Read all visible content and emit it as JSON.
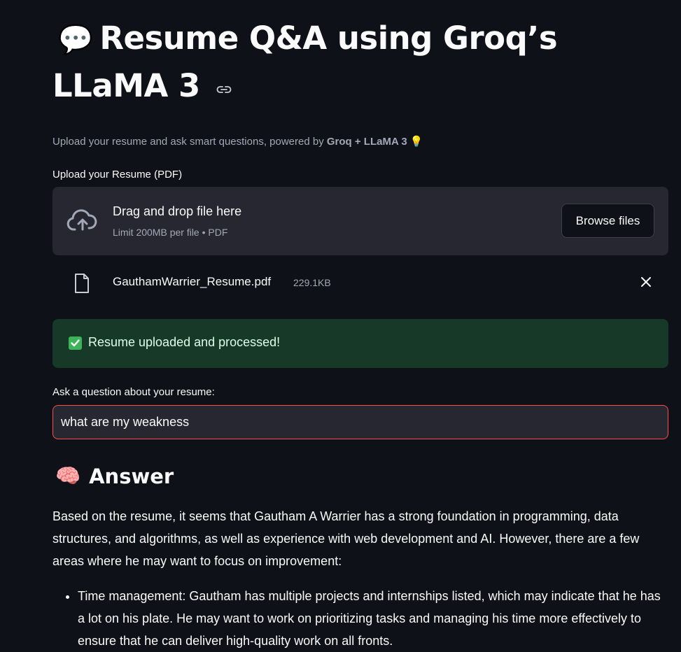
{
  "header": {
    "title_emoji": "💬",
    "title": "Resume Q&A using Groq’s LLaMA 3",
    "subtitle_prefix": "Upload your resume and ask smart questions, powered by",
    "subtitle_bold": "Groq + LLaMA 3",
    "subtitle_emoji": "💡"
  },
  "uploader": {
    "label": "Upload your Resume (PDF)",
    "dropzone_title": "Drag and drop file here",
    "dropzone_limit": "Limit 200MB per file • PDF",
    "browse_label": "Browse files",
    "file": {
      "name": "GauthamWarrier_Resume.pdf",
      "size": "229.1KB"
    }
  },
  "status": {
    "message": "Resume uploaded and processed!",
    "color": "#173928"
  },
  "question": {
    "label": "Ask a question about your resume:",
    "value": "what are my weakness"
  },
  "answer": {
    "heading_emoji": "🧠",
    "heading": "Answer",
    "intro": "Based on the resume, it seems that Gautham A Warrier has a strong foundation in programming, data structures, and algorithms, as well as experience with web development and AI. However, there are a few areas where he may want to focus on improvement:",
    "points": [
      "Time management: Gautham has multiple projects and internships listed, which may indicate that he has a lot on his plate. He may want to work on prioritizing tasks and managing his time more effectively to ensure that he can deliver high-quality work on all fronts."
    ]
  },
  "colors": {
    "background": "#0e1117",
    "surface": "#262730",
    "accent": "#ff4b4b",
    "success_bg": "#173928"
  }
}
